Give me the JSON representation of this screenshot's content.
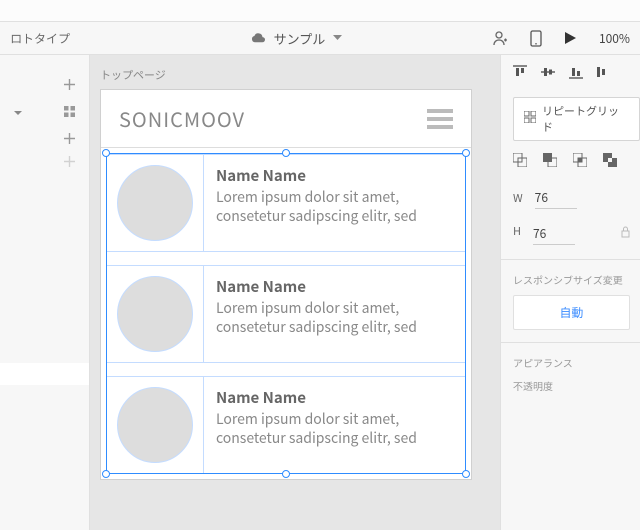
{
  "titlebar": {
    "prototype_label": "ロトタイプ",
    "doc_name": "サンプル",
    "zoom": "100%"
  },
  "artboard": {
    "label": "トップページ",
    "header_title": "SONICMOOV",
    "items": [
      {
        "name": "Name Name",
        "desc": "Lorem ipsum dolor sit amet, consetetur sadipscing elitr, sed"
      },
      {
        "name": "Name Name",
        "desc": "Lorem ipsum dolor sit amet, consetetur sadipscing elitr, sed"
      },
      {
        "name": "Name Name",
        "desc": "Lorem ipsum dolor sit amet, consetetur sadipscing elitr, sed"
      }
    ]
  },
  "panel": {
    "repeat_grid": "リピートグリッド",
    "w_label": "W",
    "w_value": "76",
    "h_label": "H",
    "h_value": "76",
    "responsive_label": "レスポンシブサイズ変更",
    "auto_label": "自動",
    "appearance_label": "アピアランス",
    "opacity_label": "不透明度"
  }
}
